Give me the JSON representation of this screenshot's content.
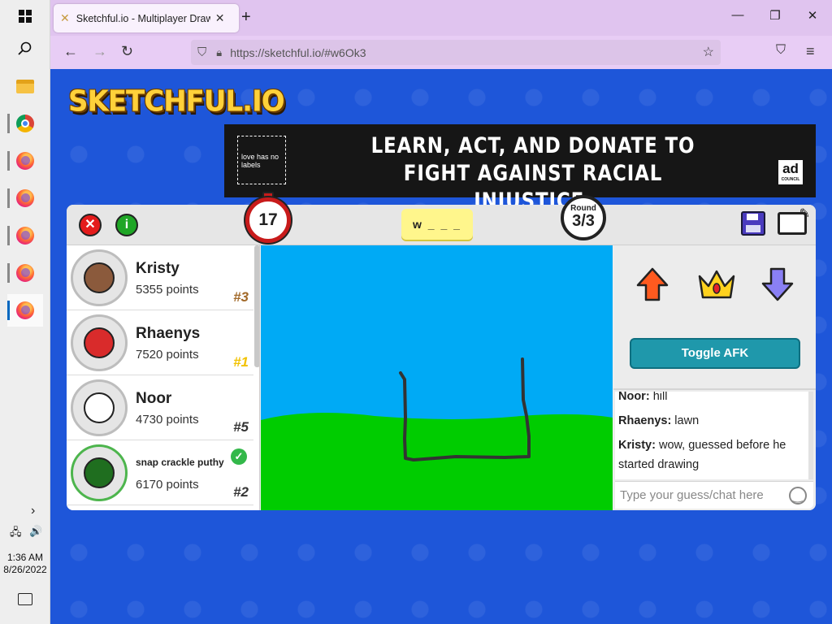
{
  "taskbar": {
    "time": "1:36 AM",
    "date": "8/26/2022"
  },
  "browser": {
    "tab_title": "Sketchful.io - Multiplayer Drawi",
    "url": "https://sketchful.io/#w6Ok3"
  },
  "site": {
    "logo": "SKETCHFUL.IO"
  },
  "ad": {
    "box_text": "love has no labels",
    "headline_1": "LEARN, ACT, AND DONATE TO",
    "headline_2": "FIGHT AGAINST RACIAL INJUSTICE.",
    "sponsor": "ad",
    "sponsor_sub": "COUNCIL"
  },
  "game": {
    "timer": "17",
    "word_hint": "w _ _ _",
    "round_label": "Round",
    "round_value": "3/3",
    "toggle_afk_label": "Toggle AFK",
    "chat_placeholder": "Type your guess/chat here"
  },
  "players": [
    {
      "name": "Kristy",
      "points": "5355 points",
      "rank": "#3",
      "avatar_color": "#8b5a3c",
      "guessed": false
    },
    {
      "name": "Rhaenys",
      "points": "7520 points",
      "rank": "#1",
      "avatar_color": "#d92b2b",
      "guessed": false
    },
    {
      "name": "Noor",
      "points": "4730 points",
      "rank": "#5",
      "avatar_color": "#ffffff",
      "guessed": false
    },
    {
      "name": "snap crackle puthy",
      "points": "6170 points",
      "rank": "#2",
      "avatar_color": "#1f6e1f",
      "guessed": true
    }
  ],
  "chat": [
    {
      "author": "Noor:",
      "text": "hill"
    },
    {
      "author": "Rhaenys:",
      "text": "lawn"
    },
    {
      "author": "Kristy:",
      "text": "wow, guessed before he started drawing"
    }
  ],
  "colors": {
    "page_bg": "#1e56d9",
    "sky": "#00aaf5",
    "grass": "#00cc00",
    "afk_button": "#1f98ab"
  }
}
